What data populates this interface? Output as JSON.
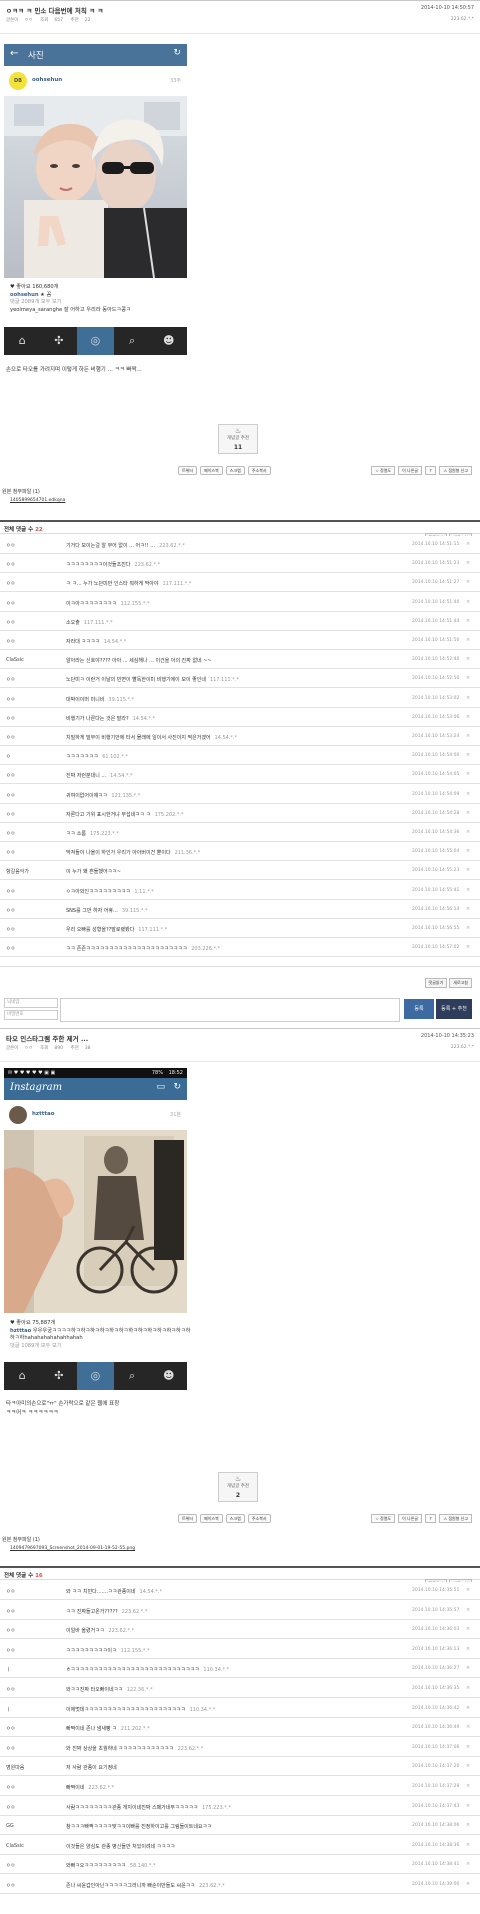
{
  "post1": {
    "title": "ㅇㅋㅋ ㅋ 민소 다음번에 처칙 ㅋ ㅋ",
    "date": "2014-10-10 14:50:57",
    "meta_author": "글쓴이",
    "meta_author_name": "ㅇㅇ",
    "meta_views_label": "조회",
    "meta_views": "657",
    "meta_rec_label": "추천",
    "meta_rec": "22",
    "ip": "223.62.*.*",
    "ig_bar_title": "사진",
    "ig_user": "oohsehun",
    "ig_avatar_text": "DB",
    "ig_time": "33주",
    "likes": "♥ 좋아요 160,680개",
    "caption_user": "oohsehun",
    "caption_text": "★ 꼼",
    "comments_more": "댓글 2089개 모두 보기",
    "comment_line": "yeolmeya_saranghe 잘 어하고 우리라 동아드ㅋ콩ㅋ",
    "body": "손으로 타오를 가려지며 이렇게 하든 비행기 ... ㅋㅋ 빠짝...",
    "vote_label": "개념글 추천",
    "vote_count": "11"
  },
  "share_buttons": [
    "트위터",
    "페이스북",
    "스크랩",
    "주소복사"
  ],
  "tool_buttons": [
    "☆ 정렬도",
    "이 나른글",
    "↑",
    "⚠ 점원형 신고"
  ],
  "attach1": {
    "label": "원본 첨부파일 (1)",
    "file": "1405899654701.edkqna"
  },
  "comments1": {
    "title": "전체 댓글 수",
    "count": "22",
    "btn_a": "댓글읽기",
    "btn_b": "새로고침",
    "rows": [
      {
        "nick": "ㅇㅇ",
        "text": "기거다 보이는걸 알 무어 없이 ... 어ㅋ!! ...",
        "ip": "223.62.*.*",
        "date": "2014.10.10 14:51:15"
      },
      {
        "nick": "ㅇㅇ",
        "text": "ㅋㅋㅋㅋㅋㅋㅋㅋ이것들조진다",
        "ip": "223.62.*.*",
        "date": "2014.10.10 14:51:23"
      },
      {
        "nick": "ㅇㅇ",
        "text": "ㅋ ㅋ... 누가 노단미만 인스타 뭐하게 막아야",
        "ip": "117.111.*.*",
        "date": "2014.10.10 14:51:27"
      },
      {
        "nick": "ㅇㅇ",
        "text": "이ㅋ아ㅋㅋㅋㅋㅋㅋㅋㅋ",
        "ip": "112.155.*.*",
        "date": "2014.10.10 14:51:40"
      },
      {
        "nick": "ㅇㅇ",
        "text": "소오출",
        "ip": "117.111.*.*",
        "date": "2014.10.10 14:51:44"
      },
      {
        "nick": "ㅇㅇ",
        "text": "자라대 ㅋㅋㅋㅋ",
        "ip": "14.54.*.*",
        "date": "2014.10.10 14:51:50"
      },
      {
        "nick": "ClaSsic",
        "text": "알아라는 신호야???? 아아 ... 세심해나 ... 이건을 아의 진짜 없네 ~~",
        "ip": "",
        "date": "2014.10.10 14:52:40"
      },
      {
        "nick": "ㅇㅇ",
        "text": "노단미ㅋ 이런거 이날의 빈면이 빨독한이미 비행기에이 보이 좋인네",
        "ip": "117.111.*.*",
        "date": "2014.10.10 14:52:50"
      },
      {
        "nick": "ㅇㅇ",
        "text": "대박이이머 미니비",
        "ip": "39.115.*.*",
        "date": "2014.10.10 14:53:02"
      },
      {
        "nick": "ㅇㅇ",
        "text": "비행기가 나른다는 것은 말라?",
        "ip": "14.54.*.*",
        "date": "2014.10.10 14:53:06"
      },
      {
        "nick": "ㅇㅇ",
        "text": "치밀하게 밀부이 비행기안에 타서 몰래에 일이서 사진이지 찍은거겠어",
        "ip": "14.54.*.*",
        "date": "2014.10.10 14:53:24"
      },
      {
        "nick": "ㅇ",
        "text": "ㅋㅋㅋㅋㅋㅋㅋ",
        "ip": "61.102.*.*",
        "date": "2014.10.10 14:54:00"
      },
      {
        "nick": "ㅇㅇ",
        "text": "진짜 저런분대니 ...",
        "ip": "14.54.*.*",
        "date": "2014.10.10 14:54:05"
      },
      {
        "nick": "ㅇㅇ",
        "text": "귀여이없어이얘ㅋㅋ",
        "ip": "121.135.*.*",
        "date": "2014.10.10 14:54:09"
      },
      {
        "nick": "ㅇㅇ",
        "text": "자론다고 기위 표시한거냐 무섭네ㅋㅋ ㅋ",
        "ip": "175.202.*.*",
        "date": "2014.10.10 14:54:28"
      },
      {
        "nick": "ㅇㅇ",
        "text": "ㅋㅋ 소름",
        "ip": "175.223.*.*",
        "date": "2014.10.10 14:54:36"
      },
      {
        "nick": "ㅇㅇ",
        "text": "막져들이 나올이 하인가 우리가 아아버이건 뿐이다",
        "ip": "211.36.*.*",
        "date": "2014.10.10 14:55:04"
      },
      {
        "nick": "항갈음악가",
        "text": "이 누가 왜 흔들했어ㅋㅋ~",
        "ip": "",
        "date": "2014.10.10 14:55:23"
      },
      {
        "nick": "ㅇㅇ",
        "text": "ㅇㅋ아외인ㅋㅋㅋㅋㅋㅋㅋㅋㅋ",
        "ip": "1.11.*.*",
        "date": "2014.10.10 14:55:41"
      },
      {
        "nick": "ㅇㅇ",
        "text": "SNS를 그만 하자 어휴...",
        "ip": "39.115.*.*",
        "date": "2014.10.10 14:56:14"
      },
      {
        "nick": "ㅇㅇ",
        "text": "우리 오빠를 성형을??발로랬봤다",
        "ip": "117.111.*.*",
        "date": "2014.10.10 14:56:55"
      },
      {
        "nick": "ㅇㅇ",
        "text": "ㅋㅋ 존존ㅋㅋㅋㅋㅋㅋㅋㅋㅋㅋㅋㅋㅋㅋㅋㅋㅋㅋㅋㅋㅋㅋ",
        "ip": "203.226.*.*",
        "date": "2014.10.10 14:57:02"
      }
    ]
  },
  "write": {
    "name_ph": "닉네임",
    "pw_ph": "비밀번호",
    "submit": "등록",
    "submit_rec": "등록 + 추천"
  },
  "post2": {
    "title": "타오 인스타그램 주한 제거 ...",
    "date": "2014-10-10 14:35:23",
    "meta_author": "글쓴이",
    "meta_author_name": "ㅇㅇ",
    "meta_views_label": "조회",
    "meta_views": "890",
    "meta_rec_label": "추천",
    "meta_rec": "38",
    "ip": "223.62.*.*",
    "status_time": "18:52",
    "status_batt": "78%",
    "ig_logo": "Instagram",
    "ig_user": "hztttao",
    "ig_time": "31분",
    "likes": "♥ 좋아요 75,887개",
    "caption_user": "hztttao",
    "caption_text": "우우우궁ㅋㅋㅋㅋ하ㅋ하ㅋ하ㅋ하ㅋ하ㅋ하ㅋ하ㅋ하ㅋ하ㅋ하ㅋ하ㅋ하ㅋ하",
    "caption_text2": "하ㅋ하hahahahahahahhahah",
    "comments_more": "댓글 1089개 모두 보기",
    "body1": "타ㅋ아미의손으로\"ㅠ\" 손가락으로 같은 웹에 표창",
    "body2": "ㅋㅋ어ㅋ ㅋㅋㅋㅋㅋㅋ",
    "vote_label": "개념글 추천",
    "vote_count": "2"
  },
  "attach2": {
    "label": "원본 첨부파일 (1)",
    "file": "1409479697093_Screenshot_2014-09-01-19-52-55.png"
  },
  "comments2": {
    "title": "전체 댓글 수",
    "count": "16",
    "btn_a": "댓글읽기",
    "btn_b": "새로고침",
    "rows": [
      {
        "nick": "ㅇㅇ",
        "text": "와 ㅋㅋ 치민다.......ㅋㅋ관종이네",
        "ip": "14.54.*.*",
        "date": "2014.10.10 14:35:51"
      },
      {
        "nick": "ㅇㅇ",
        "text": "ㅋㅋ 진짜들고온거?????",
        "ip": "223.62.*.*",
        "date": "2014.10.10 14:35:57"
      },
      {
        "nick": "ㅇㅇ",
        "text": "이일바 올렸거ㅋㅋ",
        "ip": "223.62.*.*",
        "date": "2014.10.10 14:36:03"
      },
      {
        "nick": "ㅇㅇ",
        "text": "ㅋㅋㅋㅋㅋㅋㅋㅋㅋ이ㅋ",
        "ip": "112.155.*.*",
        "date": "2014.10.10 14:36:13"
      },
      {
        "nick": "ㅣ",
        "text": "ㅎㅋㅋㅋㅋㅋㅋㅋㅋㅋㅋㅋㅋㅋㅋㅋㅋㅋㅋㅋㅋㅋㅋㅋㅋㅋㅋㅋㅋ",
        "ip": "110.34.*.*",
        "date": "2014.10.10 14:36:27"
      },
      {
        "nick": "ㅇㅇ",
        "text": "와ㅋㅋ진짜 타오빠이네ㅋㅋ",
        "ip": "122.36.*.*",
        "date": "2014.10.10 14:36:35"
      },
      {
        "nick": "ㅣ",
        "text": "이에멋데ㅋㅋㅋㅋㅋㅋㅋㅋㅋㅋㅋㅋㅋㅋㅋㅋㅋㅋㅋㅋㅋㅋ",
        "ip": "110.34.*.*",
        "date": "2014.10.10 14:36:42"
      },
      {
        "nick": "ㅇㅇ",
        "text": "빠짝이네 존나 냄새빵 ㅋ",
        "ip": "211.202.*.*",
        "date": "2014.10.10 14:36:49"
      },
      {
        "nick": "ㅇㅇ",
        "text": "와 진짜 상상을 초월하네 ㅋㅋㅋㅋㅋㅋㅋㅋㅋㅋㅋㅋ",
        "ip": "223.62.*.*",
        "date": "2014.10.10 14:37:06"
      },
      {
        "nick": "영원따옴",
        "text": "저 사람 관종이 요기정네",
        "ip": "",
        "date": "2014.10.10 14:37:20"
      },
      {
        "nick": "ㅇㅇ",
        "text": "빠짝이네",
        "ip": "223.62.*.*",
        "date": "2014.10.10 14:37:28"
      },
      {
        "nick": "ㅇㅇ",
        "text": "사람ㅋㅋㅋㅋㅋㅋㅋㅋ관종 개지이네진짜 스페가네무ㅋㅋㅋㅋㅋ",
        "ip": "175.223.*.*",
        "date": "2014.10.10 14:37:43"
      },
      {
        "nick": "GG",
        "text": "참ㅋㅋㅋ빠짝ㅋㅋㅋㅋ맞ㅋㅋ이빠를 진정하이고를 그림들이트네요ㅋㅋ",
        "ip": "",
        "date": "2014.10.10 14:38:06"
      },
      {
        "nick": "ClaSsic",
        "text": "이것들은 양심도 관종 병신들만 처있이려네 ㅋㅋㅋㅋ",
        "ip": "",
        "date": "2014.10.10 14:38:36"
      },
      {
        "nick": "ㅇㅇ",
        "text": "와빠ㅋ오ㅋㅋㅋㅋㅋㅋㅋㅋㅋ",
        "ip": "58.140.*.*",
        "date": "2014.10.10 14:38:41"
      },
      {
        "nick": "ㅇㅇ",
        "text": "존나 씨윤겁인아닌ㅋㅋㅋㅋㅋ그러니까 빠순이만들도 씨윤ㅋㅋ",
        "ip": "223.62.*.*",
        "date": "2014.10.10 14:39:00"
      }
    ]
  },
  "icons": {
    "back": "←",
    "refresh": "↻",
    "home": "⌂",
    "explore": "✣",
    "camera": "◎",
    "activity": "⌕",
    "profile": "☻",
    "close": "×",
    "comment": "✎"
  }
}
